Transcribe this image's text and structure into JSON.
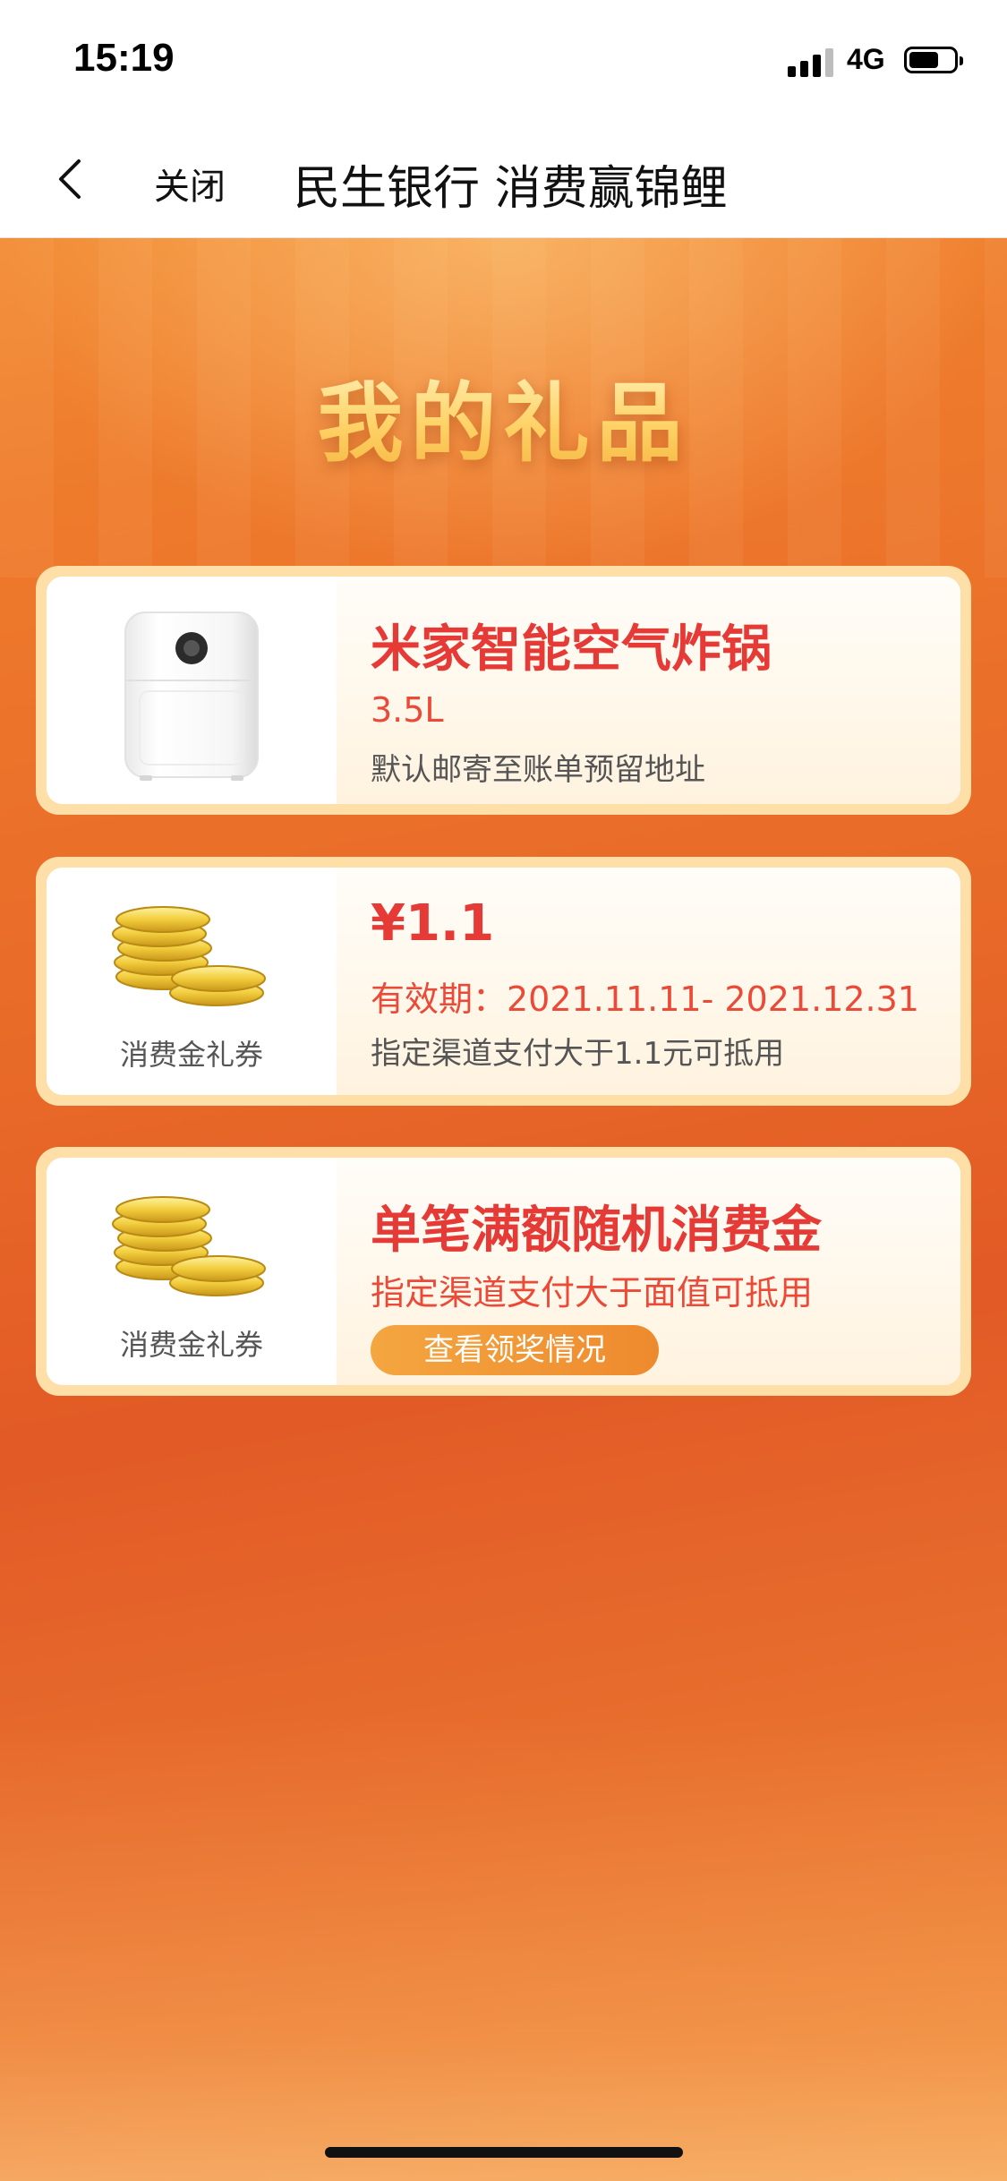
{
  "status_bar": {
    "time": "15:19",
    "network": "4G"
  },
  "nav": {
    "close_label": "关闭",
    "title": "民生银行 消费赢锦鲤"
  },
  "page": {
    "heading": "我的礼品"
  },
  "gifts": [
    {
      "title": "米家智能空气炸锅",
      "spec": "3.5L",
      "note": "默认邮寄至账单预留地址",
      "image_icon": "air-fryer-icon"
    },
    {
      "image_label": "消费金礼券",
      "title": "¥1.1",
      "validity": "有效期：2021.11.11- 2021.12.31",
      "note": "指定渠道支付大于1.1元可抵用",
      "image_icon": "gold-coins-icon"
    },
    {
      "image_label": "消费金礼券",
      "title": "单笔满额随机消费金",
      "note": "指定渠道支付大于面值可抵用",
      "button_label": "查看领奖情况",
      "image_icon": "gold-coins-icon"
    }
  ],
  "colors": {
    "accent_red": "#e63a36",
    "background_orange": "#e86a28",
    "card_border": "#ffdfa8",
    "button_orange": "#f09a36"
  }
}
